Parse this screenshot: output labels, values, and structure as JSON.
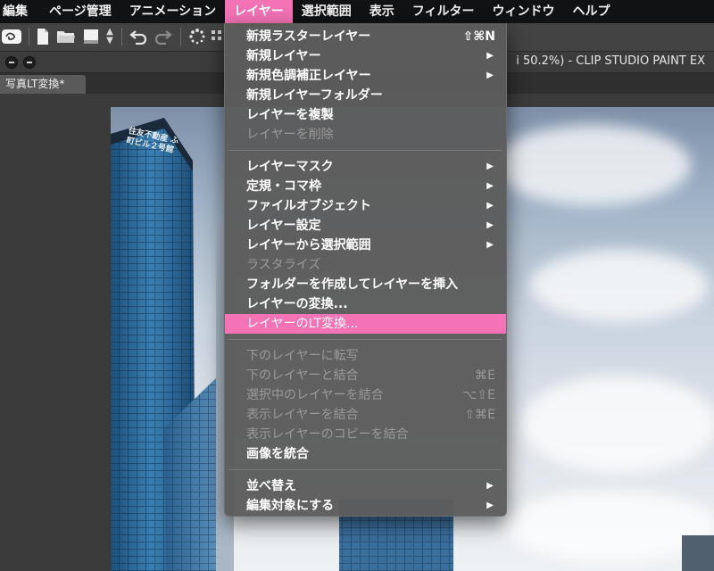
{
  "menubar": {
    "items": [
      {
        "label": "編集"
      },
      {
        "label": "ページ管理"
      },
      {
        "label": "アニメーション"
      },
      {
        "label": "レイヤー",
        "active": true
      },
      {
        "label": "選択範囲"
      },
      {
        "label": "表示"
      },
      {
        "label": "フィルター"
      },
      {
        "label": "ウィンドウ"
      },
      {
        "label": "ヘルプ"
      }
    ]
  },
  "window": {
    "title": "i 50.2%)  - CLIP STUDIO PAINT EX"
  },
  "document_tab": {
    "label": "写真LT変換*"
  },
  "photo": {
    "building_sign": "住友不動産 ふ町ビル２号館"
  },
  "layer_menu": {
    "highlight_color": "#f472b6",
    "groups": [
      [
        {
          "label": "新規ラスターレイヤー",
          "shortcut": "⇧⌘N",
          "enabled": true,
          "submenu": false
        },
        {
          "label": "新規レイヤー",
          "shortcut": "",
          "enabled": true,
          "submenu": true
        },
        {
          "label": "新規色調補正レイヤー",
          "shortcut": "",
          "enabled": true,
          "submenu": true
        },
        {
          "label": "新規レイヤーフォルダー",
          "shortcut": "",
          "enabled": true,
          "submenu": false
        },
        {
          "label": "レイヤーを複製",
          "shortcut": "",
          "enabled": true,
          "submenu": false
        },
        {
          "label": "レイヤーを削除",
          "shortcut": "",
          "enabled": false,
          "submenu": false
        }
      ],
      [
        {
          "label": "レイヤーマスク",
          "shortcut": "",
          "enabled": true,
          "submenu": true
        },
        {
          "label": "定規・コマ枠",
          "shortcut": "",
          "enabled": true,
          "submenu": true
        },
        {
          "label": "ファイルオブジェクト",
          "shortcut": "",
          "enabled": true,
          "submenu": true
        },
        {
          "label": "レイヤー設定",
          "shortcut": "",
          "enabled": true,
          "submenu": true
        },
        {
          "label": "レイヤーから選択範囲",
          "shortcut": "",
          "enabled": true,
          "submenu": true
        },
        {
          "label": "ラスタライズ",
          "shortcut": "",
          "enabled": false,
          "submenu": false
        },
        {
          "label": "フォルダーを作成してレイヤーを挿入",
          "shortcut": "",
          "enabled": true,
          "submenu": false
        },
        {
          "label": "レイヤーの変換...",
          "shortcut": "",
          "enabled": true,
          "submenu": false
        },
        {
          "label": "レイヤーのLT変換...",
          "shortcut": "",
          "enabled": true,
          "submenu": false,
          "highlighted": true
        }
      ],
      [
        {
          "label": "下のレイヤーに転写",
          "shortcut": "",
          "enabled": false,
          "submenu": false
        },
        {
          "label": "下のレイヤーと結合",
          "shortcut": "⌘E",
          "enabled": false,
          "submenu": false
        },
        {
          "label": "選択中のレイヤーを結合",
          "shortcut": "⌥⇧E",
          "enabled": false,
          "submenu": false
        },
        {
          "label": "表示レイヤーを結合",
          "shortcut": "⇧⌘E",
          "enabled": false,
          "submenu": false
        },
        {
          "label": "表示レイヤーのコピーを結合",
          "shortcut": "",
          "enabled": false,
          "submenu": false
        },
        {
          "label": "画像を統合",
          "shortcut": "",
          "enabled": true,
          "submenu": false
        }
      ],
      [
        {
          "label": "並べ替え",
          "shortcut": "",
          "enabled": true,
          "submenu": true
        },
        {
          "label": "編集対象にする",
          "shortcut": "",
          "enabled": true,
          "submenu": true
        }
      ]
    ]
  }
}
